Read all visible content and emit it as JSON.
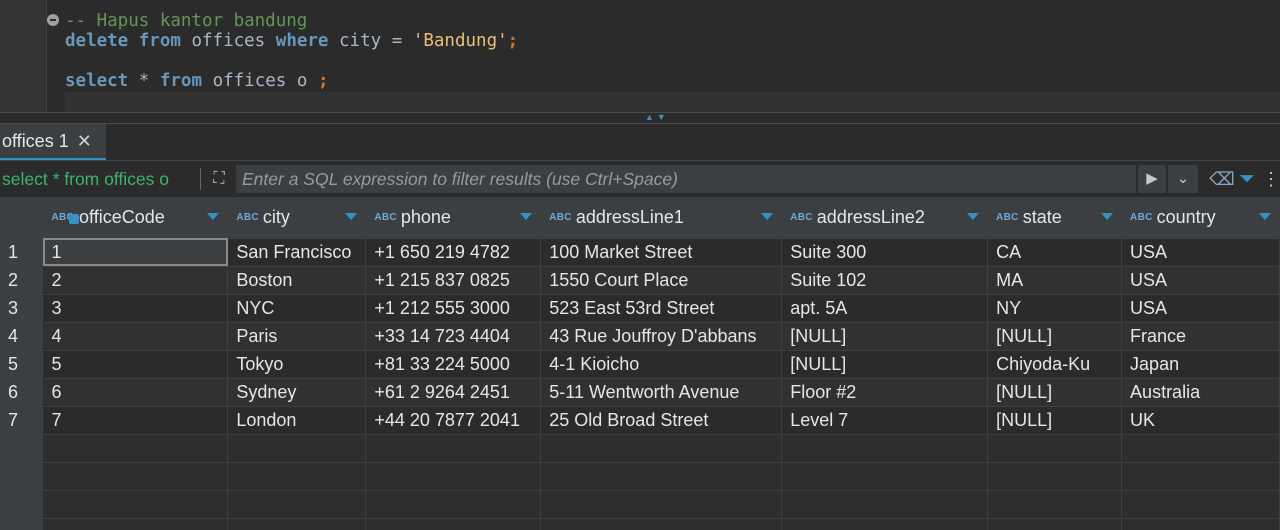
{
  "editor": {
    "comment": "-- Hapus kantor bandung",
    "line2": {
      "kw1": "delete",
      "kw2": "from",
      "table": "offices",
      "kw3": "where",
      "col": "city",
      "op": "=",
      "str": "'Bandung'",
      "semi": ";"
    },
    "line3": {
      "kw1": "select",
      "star": "*",
      "kw2": "from",
      "table": "offices",
      "alias": "o",
      "semi": ";"
    }
  },
  "tab": {
    "label": "offices 1",
    "close": "✕"
  },
  "filter": {
    "query": "select * from offices o",
    "placeholder": "Enter a SQL expression to filter results (use Ctrl+Space)"
  },
  "columns": [
    {
      "type": "ABC",
      "name": "officeCode"
    },
    {
      "type": "ABC",
      "name": "city"
    },
    {
      "type": "ABC",
      "name": "phone"
    },
    {
      "type": "ABC",
      "name": "addressLine1"
    },
    {
      "type": "ABC",
      "name": "addressLine2"
    },
    {
      "type": "ABC",
      "name": "state"
    },
    {
      "type": "ABC",
      "name": "country"
    }
  ],
  "rows": [
    {
      "num": "1",
      "cells": [
        "1",
        "San Francisco",
        "+1 650 219 4782",
        "100 Market Street",
        "Suite 300",
        "CA",
        "USA"
      ]
    },
    {
      "num": "2",
      "cells": [
        "2",
        "Boston",
        "+1 215 837 0825",
        "1550 Court Place",
        "Suite 102",
        "MA",
        "USA"
      ]
    },
    {
      "num": "3",
      "cells": [
        "3",
        "NYC",
        "+1 212 555 3000",
        "523 East 53rd Street",
        "apt. 5A",
        "NY",
        "USA"
      ]
    },
    {
      "num": "4",
      "cells": [
        "4",
        "Paris",
        "+33 14 723 4404",
        "43 Rue Jouffroy D'abbans",
        "[NULL]",
        "[NULL]",
        "France"
      ]
    },
    {
      "num": "5",
      "cells": [
        "5",
        "Tokyo",
        "+81 33 224 5000",
        "4-1 Kioicho",
        "[NULL]",
        "Chiyoda-Ku",
        "Japan"
      ]
    },
    {
      "num": "6",
      "cells": [
        "6",
        "Sydney",
        "+61 2 9264 2451",
        "5-11 Wentworth Avenue",
        "Floor #2",
        "[NULL]",
        "Australia"
      ]
    },
    {
      "num": "7",
      "cells": [
        "7",
        "London",
        "+44 20 7877 2041",
        "25 Old Broad Street",
        "Level 7",
        "[NULL]",
        "UK"
      ]
    }
  ]
}
